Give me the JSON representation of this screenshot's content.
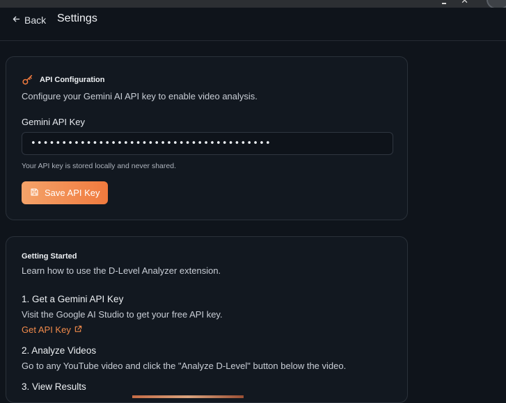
{
  "header": {
    "back_label": "Back",
    "title": "Settings"
  },
  "api_config": {
    "icon": "key-icon",
    "heading": "API Configuration",
    "description": "Configure your Gemini AI API key to enable video analysis.",
    "field_label": "Gemini API Key",
    "field_value": "•••••••••••••••••••••••••••••••••••••••",
    "hint": "Your API key is stored locally and never shared.",
    "save_label": "Save API Key",
    "accent_color": "#f07a3e"
  },
  "getting_started": {
    "heading": "Getting Started",
    "description": "Learn how to use the D-Level Analyzer extension.",
    "steps": [
      {
        "title": "1. Get a Gemini API Key",
        "description": "Visit the Google AI Studio to get your free API key.",
        "link_label": "Get API Key"
      },
      {
        "title": "2. Analyze Videos",
        "description": "Go to any YouTube video and click the \"Analyze D-Level\" button below the video."
      },
      {
        "title": "3. View Results"
      }
    ]
  }
}
